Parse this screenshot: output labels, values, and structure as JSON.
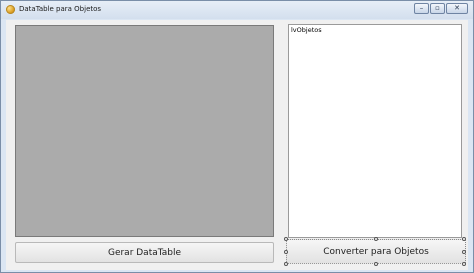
{
  "window": {
    "title": "DataTable para Objetos",
    "icon": "app-icon",
    "caption_buttons": {
      "minimize": "–",
      "maximize": "▫",
      "close": "✕"
    }
  },
  "main": {
    "grid_panel": {
      "background": "#ababab"
    },
    "listview": {
      "label": "lvObjetos"
    },
    "buttons": {
      "gerar_label": "Gerar DataTable",
      "converter_label": "Converter para Objetos"
    }
  }
}
